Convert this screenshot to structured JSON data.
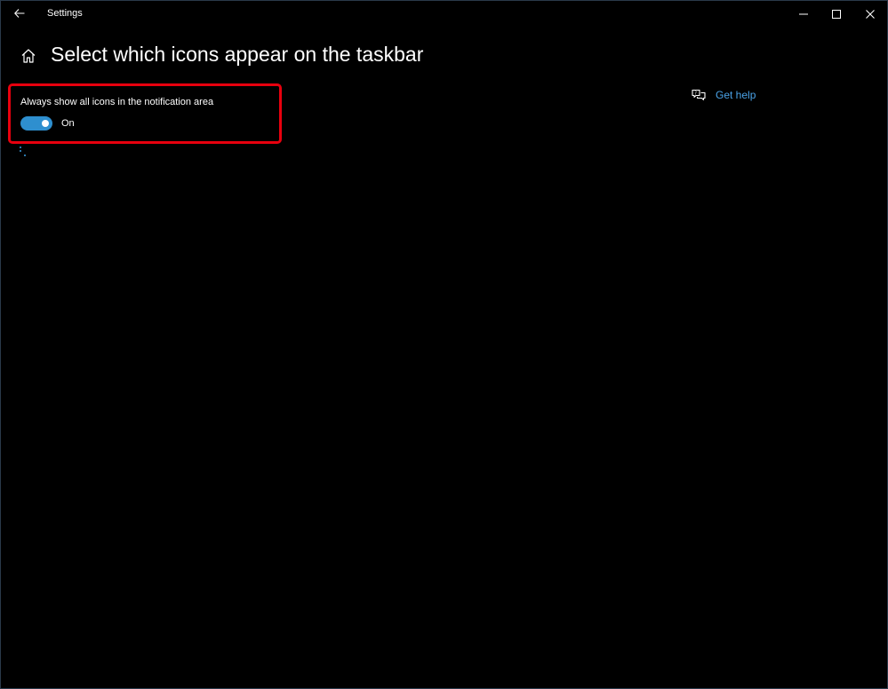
{
  "window": {
    "app_title": "Settings",
    "controls": {
      "minimize": "minimize-icon",
      "maximize": "maximize-icon",
      "close": "close-icon"
    }
  },
  "header": {
    "home_icon": "home-icon",
    "title": "Select which icons appear on the taskbar"
  },
  "notification_setting": {
    "label": "Always show all icons in the notification area",
    "state": "On",
    "enabled": true,
    "accent_color": "#2e8fcf",
    "highlight_color": "#e8000e"
  },
  "help": {
    "icon": "help-chat-icon",
    "label": "Get help",
    "link_color": "#4aa3e8"
  }
}
